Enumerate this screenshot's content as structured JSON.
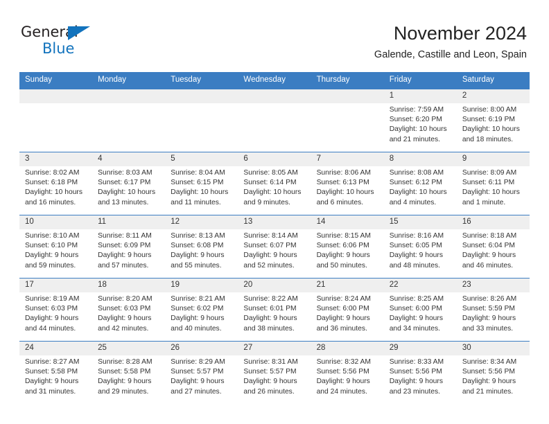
{
  "brand": {
    "name_part1": "General",
    "name_part2": "Blue",
    "accent_color": "#1273bd"
  },
  "header": {
    "title": "November 2024",
    "subtitle": "Galende, Castille and Leon, Spain"
  },
  "theme": {
    "header_blue": "#3b7dc2",
    "day_strip_gray": "#efefef"
  },
  "weekdays": [
    "Sunday",
    "Monday",
    "Tuesday",
    "Wednesday",
    "Thursday",
    "Friday",
    "Saturday"
  ],
  "weeks": [
    [
      {
        "day": "",
        "empty": true
      },
      {
        "day": "",
        "empty": true
      },
      {
        "day": "",
        "empty": true
      },
      {
        "day": "",
        "empty": true
      },
      {
        "day": "",
        "empty": true
      },
      {
        "day": "1",
        "sunrise": "Sunrise: 7:59 AM",
        "sunset": "Sunset: 6:20 PM",
        "daylight1": "Daylight: 10 hours",
        "daylight2": "and 21 minutes."
      },
      {
        "day": "2",
        "sunrise": "Sunrise: 8:00 AM",
        "sunset": "Sunset: 6:19 PM",
        "daylight1": "Daylight: 10 hours",
        "daylight2": "and 18 minutes."
      }
    ],
    [
      {
        "day": "3",
        "sunrise": "Sunrise: 8:02 AM",
        "sunset": "Sunset: 6:18 PM",
        "daylight1": "Daylight: 10 hours",
        "daylight2": "and 16 minutes."
      },
      {
        "day": "4",
        "sunrise": "Sunrise: 8:03 AM",
        "sunset": "Sunset: 6:17 PM",
        "daylight1": "Daylight: 10 hours",
        "daylight2": "and 13 minutes."
      },
      {
        "day": "5",
        "sunrise": "Sunrise: 8:04 AM",
        "sunset": "Sunset: 6:15 PM",
        "daylight1": "Daylight: 10 hours",
        "daylight2": "and 11 minutes."
      },
      {
        "day": "6",
        "sunrise": "Sunrise: 8:05 AM",
        "sunset": "Sunset: 6:14 PM",
        "daylight1": "Daylight: 10 hours",
        "daylight2": "and 9 minutes."
      },
      {
        "day": "7",
        "sunrise": "Sunrise: 8:06 AM",
        "sunset": "Sunset: 6:13 PM",
        "daylight1": "Daylight: 10 hours",
        "daylight2": "and 6 minutes."
      },
      {
        "day": "8",
        "sunrise": "Sunrise: 8:08 AM",
        "sunset": "Sunset: 6:12 PM",
        "daylight1": "Daylight: 10 hours",
        "daylight2": "and 4 minutes."
      },
      {
        "day": "9",
        "sunrise": "Sunrise: 8:09 AM",
        "sunset": "Sunset: 6:11 PM",
        "daylight1": "Daylight: 10 hours",
        "daylight2": "and 1 minute."
      }
    ],
    [
      {
        "day": "10",
        "sunrise": "Sunrise: 8:10 AM",
        "sunset": "Sunset: 6:10 PM",
        "daylight1": "Daylight: 9 hours",
        "daylight2": "and 59 minutes."
      },
      {
        "day": "11",
        "sunrise": "Sunrise: 8:11 AM",
        "sunset": "Sunset: 6:09 PM",
        "daylight1": "Daylight: 9 hours",
        "daylight2": "and 57 minutes."
      },
      {
        "day": "12",
        "sunrise": "Sunrise: 8:13 AM",
        "sunset": "Sunset: 6:08 PM",
        "daylight1": "Daylight: 9 hours",
        "daylight2": "and 55 minutes."
      },
      {
        "day": "13",
        "sunrise": "Sunrise: 8:14 AM",
        "sunset": "Sunset: 6:07 PM",
        "daylight1": "Daylight: 9 hours",
        "daylight2": "and 52 minutes."
      },
      {
        "day": "14",
        "sunrise": "Sunrise: 8:15 AM",
        "sunset": "Sunset: 6:06 PM",
        "daylight1": "Daylight: 9 hours",
        "daylight2": "and 50 minutes."
      },
      {
        "day": "15",
        "sunrise": "Sunrise: 8:16 AM",
        "sunset": "Sunset: 6:05 PM",
        "daylight1": "Daylight: 9 hours",
        "daylight2": "and 48 minutes."
      },
      {
        "day": "16",
        "sunrise": "Sunrise: 8:18 AM",
        "sunset": "Sunset: 6:04 PM",
        "daylight1": "Daylight: 9 hours",
        "daylight2": "and 46 minutes."
      }
    ],
    [
      {
        "day": "17",
        "sunrise": "Sunrise: 8:19 AM",
        "sunset": "Sunset: 6:03 PM",
        "daylight1": "Daylight: 9 hours",
        "daylight2": "and 44 minutes."
      },
      {
        "day": "18",
        "sunrise": "Sunrise: 8:20 AM",
        "sunset": "Sunset: 6:03 PM",
        "daylight1": "Daylight: 9 hours",
        "daylight2": "and 42 minutes."
      },
      {
        "day": "19",
        "sunrise": "Sunrise: 8:21 AM",
        "sunset": "Sunset: 6:02 PM",
        "daylight1": "Daylight: 9 hours",
        "daylight2": "and 40 minutes."
      },
      {
        "day": "20",
        "sunrise": "Sunrise: 8:22 AM",
        "sunset": "Sunset: 6:01 PM",
        "daylight1": "Daylight: 9 hours",
        "daylight2": "and 38 minutes."
      },
      {
        "day": "21",
        "sunrise": "Sunrise: 8:24 AM",
        "sunset": "Sunset: 6:00 PM",
        "daylight1": "Daylight: 9 hours",
        "daylight2": "and 36 minutes."
      },
      {
        "day": "22",
        "sunrise": "Sunrise: 8:25 AM",
        "sunset": "Sunset: 6:00 PM",
        "daylight1": "Daylight: 9 hours",
        "daylight2": "and 34 minutes."
      },
      {
        "day": "23",
        "sunrise": "Sunrise: 8:26 AM",
        "sunset": "Sunset: 5:59 PM",
        "daylight1": "Daylight: 9 hours",
        "daylight2": "and 33 minutes."
      }
    ],
    [
      {
        "day": "24",
        "sunrise": "Sunrise: 8:27 AM",
        "sunset": "Sunset: 5:58 PM",
        "daylight1": "Daylight: 9 hours",
        "daylight2": "and 31 minutes."
      },
      {
        "day": "25",
        "sunrise": "Sunrise: 8:28 AM",
        "sunset": "Sunset: 5:58 PM",
        "daylight1": "Daylight: 9 hours",
        "daylight2": "and 29 minutes."
      },
      {
        "day": "26",
        "sunrise": "Sunrise: 8:29 AM",
        "sunset": "Sunset: 5:57 PM",
        "daylight1": "Daylight: 9 hours",
        "daylight2": "and 27 minutes."
      },
      {
        "day": "27",
        "sunrise": "Sunrise: 8:31 AM",
        "sunset": "Sunset: 5:57 PM",
        "daylight1": "Daylight: 9 hours",
        "daylight2": "and 26 minutes."
      },
      {
        "day": "28",
        "sunrise": "Sunrise: 8:32 AM",
        "sunset": "Sunset: 5:56 PM",
        "daylight1": "Daylight: 9 hours",
        "daylight2": "and 24 minutes."
      },
      {
        "day": "29",
        "sunrise": "Sunrise: 8:33 AM",
        "sunset": "Sunset: 5:56 PM",
        "daylight1": "Daylight: 9 hours",
        "daylight2": "and 23 minutes."
      },
      {
        "day": "30",
        "sunrise": "Sunrise: 8:34 AM",
        "sunset": "Sunset: 5:56 PM",
        "daylight1": "Daylight: 9 hours",
        "daylight2": "and 21 minutes."
      }
    ]
  ]
}
